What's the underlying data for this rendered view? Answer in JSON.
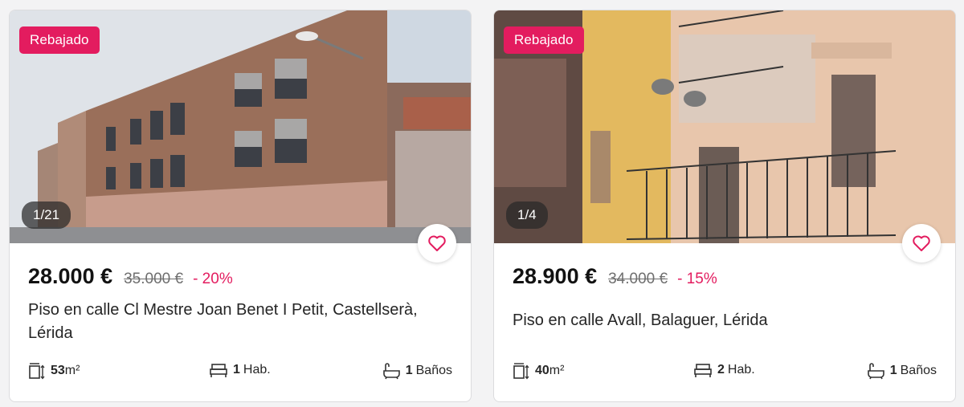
{
  "listings": [
    {
      "badge": "Rebajado",
      "photo_counter": "1/21",
      "price": "28.000 €",
      "old_price": "35.000 €",
      "discount": "- 20%",
      "title": "Piso en calle Cl Mestre Joan Benet I Petit, Castellserà, Lérida",
      "area_value": "53",
      "area_unit": "m²",
      "rooms_value": "1",
      "rooms_label": "Hab.",
      "baths_value": "1",
      "baths_label": "Baños",
      "icons": {
        "favorite": "heart-icon",
        "area": "area-measure-icon",
        "rooms": "bed-icon",
        "baths": "bathtub-icon"
      }
    },
    {
      "badge": "Rebajado",
      "photo_counter": "1/4",
      "price": "28.900 €",
      "old_price": "34.000 €",
      "discount": "- 15%",
      "title": "Piso en calle Avall, Balaguer, Lérida",
      "area_value": "40",
      "area_unit": "m²",
      "rooms_value": "2",
      "rooms_label": "Hab.",
      "baths_value": "1",
      "baths_label": "Baños",
      "icons": {
        "favorite": "heart-icon",
        "area": "area-measure-icon",
        "rooms": "bed-icon",
        "baths": "bathtub-icon"
      }
    }
  ],
  "colors": {
    "accent": "#e31c5f",
    "text": "#1a1a1a",
    "muted": "#6e6e6e",
    "card_border": "#dcdcde"
  }
}
